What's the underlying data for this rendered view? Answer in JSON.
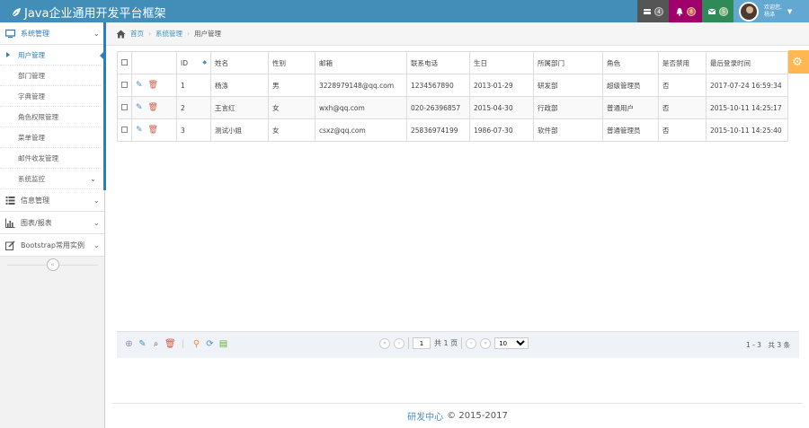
{
  "header": {
    "brand": "Java企业通用开发平台框架",
    "tasks_count": "4",
    "notifications_count": "8",
    "messages_count": "5",
    "welcome": "欢迎您,",
    "username": "杨涤",
    "colors": {
      "bar": "#438eb9",
      "tasks": "#555555",
      "notifications": "#a0006a",
      "messages": "#2e8b57",
      "user": "#62a8d1"
    }
  },
  "sidebar": {
    "menus": [
      {
        "label": "系统管理",
        "icon": "monitor-icon",
        "expanded": true,
        "items": [
          {
            "label": "用户管理",
            "active": true
          },
          {
            "label": "部门管理"
          },
          {
            "label": "字典管理"
          },
          {
            "label": "角色权限管理"
          },
          {
            "label": "菜单管理"
          },
          {
            "label": "邮件收发管理"
          },
          {
            "label": "系统监控"
          }
        ]
      },
      {
        "label": "信息管理",
        "icon": "list-icon"
      },
      {
        "label": "图表/报表",
        "icon": "bar-chart-icon"
      },
      {
        "label": "Bootstrap常用实例",
        "icon": "edit-icon"
      }
    ]
  },
  "breadcrumb": {
    "home": "首页",
    "section": "系统管理",
    "current": "用户管理"
  },
  "table": {
    "headers": [
      "ID",
      "姓名",
      "性别",
      "邮箱",
      "联系电话",
      "生日",
      "所属部门",
      "角色",
      "是否禁用",
      "最后登录时间"
    ],
    "rows": [
      [
        "1",
        "杨涤",
        "男",
        "3228979148@qq.com",
        "1234567890",
        "2013-01-29",
        "研发部",
        "超级管理员",
        "否",
        "2017-07-24 16:59:34"
      ],
      [
        "2",
        "王言红",
        "女",
        "wxh@qq.com",
        "020-26396857",
        "2015-04-30",
        "行政部",
        "普通用户",
        "否",
        "2015-10-11 14:25:17"
      ],
      [
        "3",
        "测试小姐",
        "女",
        "csxz@qq.com",
        "25836974199",
        "1986-07-30",
        "软件部",
        "普通管理员",
        "否",
        "2015-10-11 14:25:40"
      ]
    ]
  },
  "pager": {
    "page": "1",
    "total_pages": "共 1 页",
    "page_size": "10",
    "summary": "1 - 3　共 3 条"
  },
  "footer": {
    "org": "研发中心",
    "copyright": "© 2015-2017"
  }
}
